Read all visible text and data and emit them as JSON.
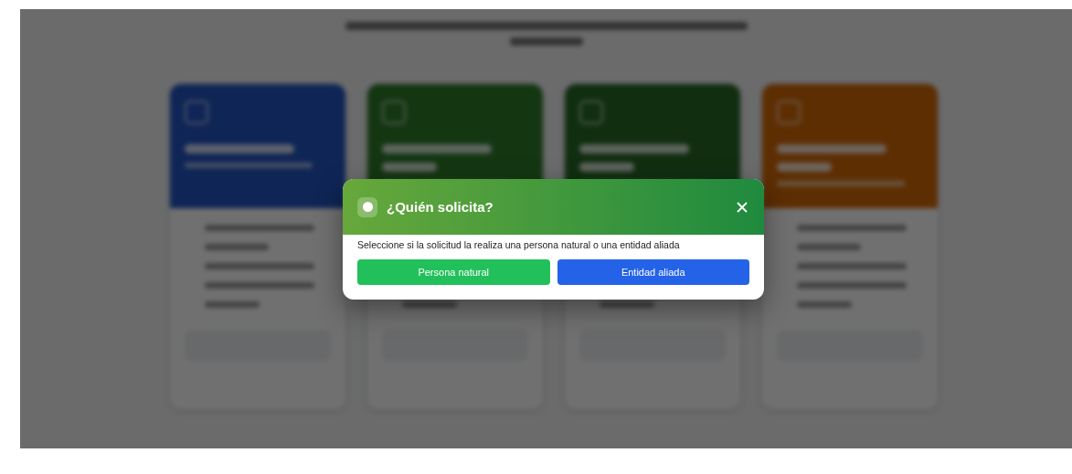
{
  "dialog": {
    "title": "¿Quién solicita?",
    "message": "Seleccione si la solicitud la realiza una persona natural o una entidad aliada",
    "buttons": [
      {
        "label": "Persona natural",
        "kind": "natural"
      },
      {
        "label": "Entidad aliada",
        "kind": "entity"
      }
    ]
  }
}
